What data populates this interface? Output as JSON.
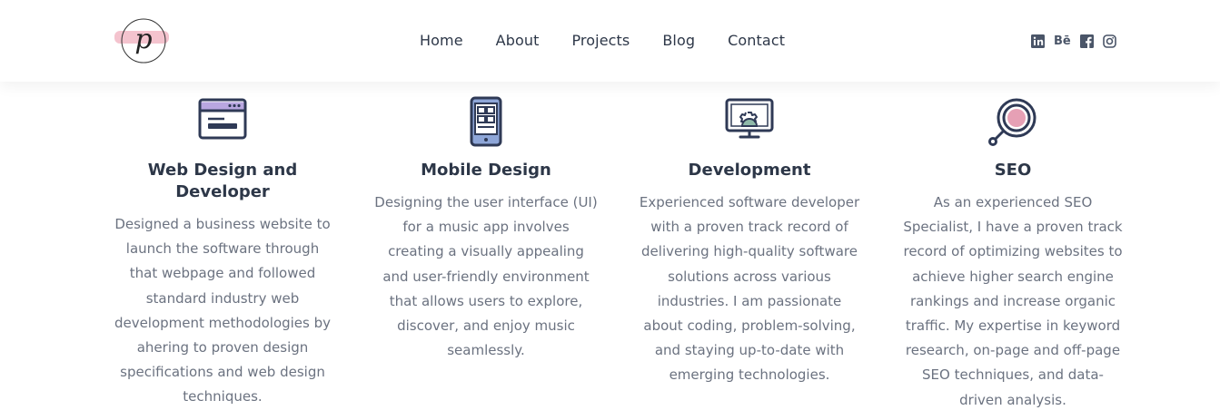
{
  "header": {
    "logo_letter": "p",
    "nav": [
      "Home",
      "About",
      "Projects",
      "Blog",
      "Contact"
    ],
    "social": [
      {
        "name": "linkedin-icon",
        "glyph": "in"
      },
      {
        "name": "behance-icon",
        "glyph": "Bē"
      },
      {
        "name": "facebook-icon",
        "glyph": "f"
      },
      {
        "name": "instagram-icon",
        "glyph": ""
      }
    ]
  },
  "services": [
    {
      "icon": "browser-window-icon",
      "title": "Web Design and Developer",
      "description": "Designed a business website to launch the software through that webpage and followed standard industry web development methodologies by ahering to proven design specifications and web design techniques."
    },
    {
      "icon": "mobile-phone-icon",
      "title": "Mobile Design",
      "description": "Designing the user interface (UI) for a music app involves creating a visually appealing and user-friendly environment that allows users to explore, discover, and enjoy music seamlessly."
    },
    {
      "icon": "monitor-gear-icon",
      "title": "Development",
      "description": "Experienced software developer with a proven track record of delivering high-quality software solutions across various industries. I am passionate about coding, problem-solving, and staying up-to-date with emerging technologies."
    },
    {
      "icon": "magnifier-icon",
      "title": "SEO",
      "description": "As an experienced SEO Specialist, I have a proven track record of optimizing websites to achieve higher search engine rankings and increase organic traffic. My expertise in keyword research, on-page and off-page SEO techniques, and data-driven analysis."
    }
  ],
  "colors": {
    "text_dark": "#2d3748",
    "text_body": "#6b7280",
    "icon_stroke": "#2f3a56",
    "accent_purple": "#b9a7e0",
    "accent_blue": "#8ea6d8",
    "accent_green": "#8fb9a8",
    "accent_pink": "#e6a0b5"
  }
}
